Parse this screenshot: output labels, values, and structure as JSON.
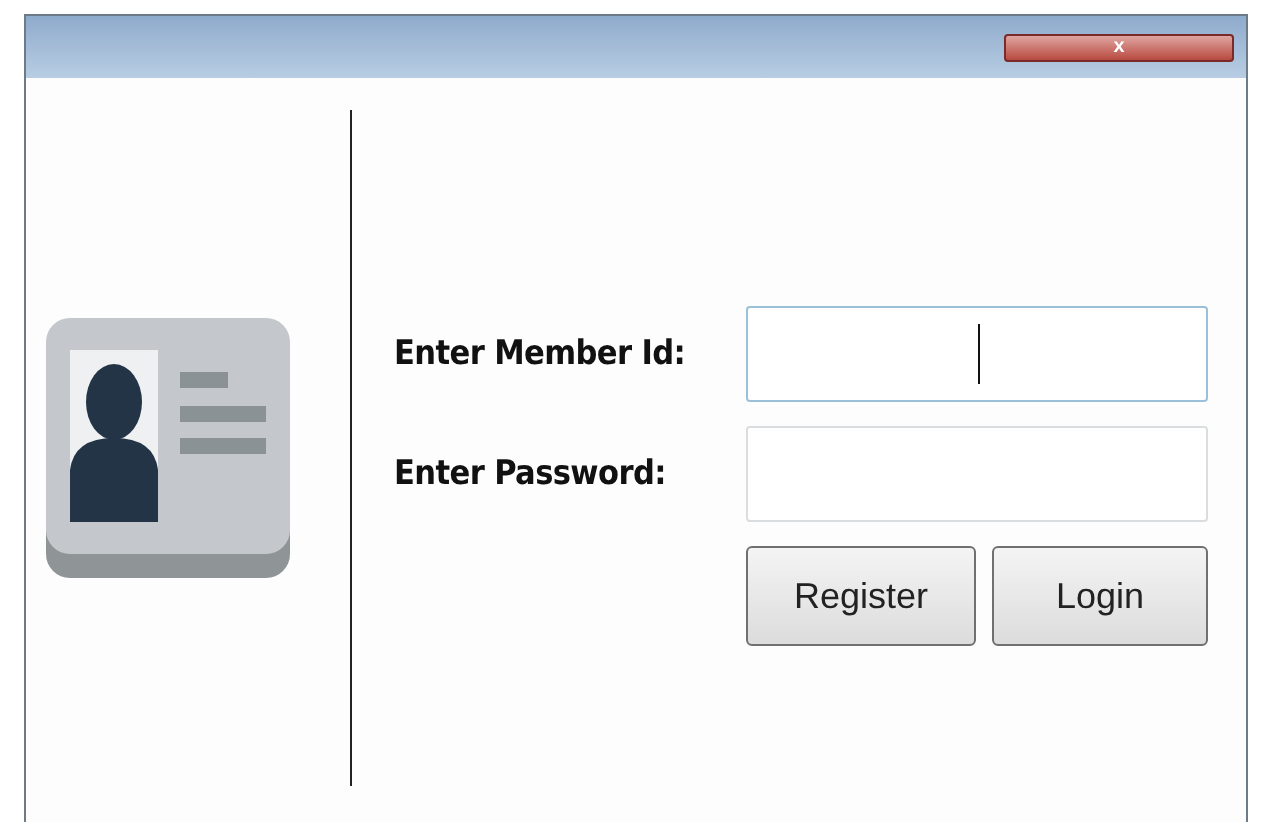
{
  "window": {
    "close_icon": "x"
  },
  "fields": [
    {
      "label": "Enter Member Id:",
      "focused": true
    },
    {
      "label": "Enter Password:",
      "focused": false
    }
  ],
  "buttons": [
    "Register",
    "Login"
  ]
}
